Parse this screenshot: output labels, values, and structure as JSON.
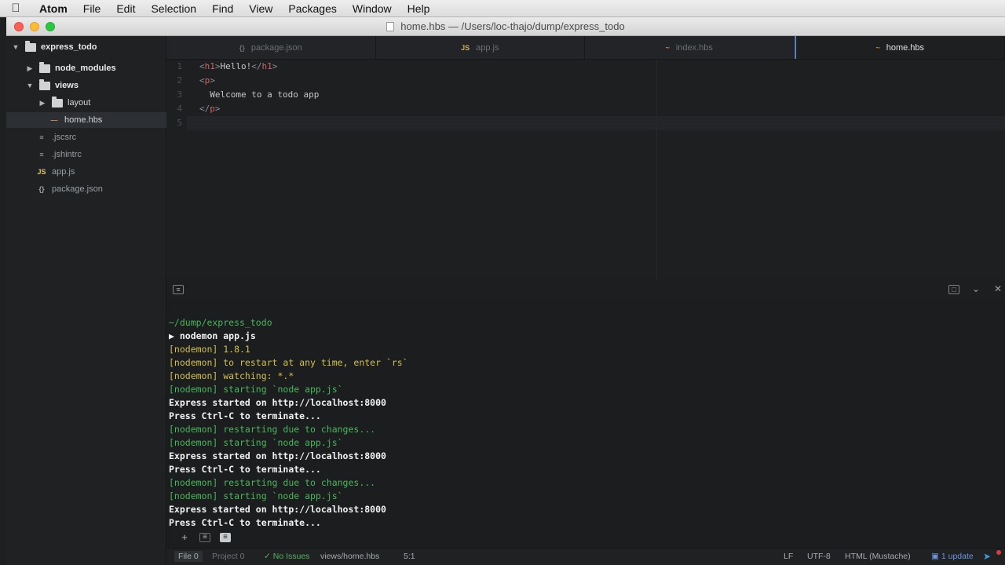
{
  "menubar": {
    "items": [
      "Atom",
      "File",
      "Edit",
      "Selection",
      "Find",
      "View",
      "Packages",
      "Window",
      "Help"
    ]
  },
  "window": {
    "title": "home.hbs — /Users/loc-thajo/dump/express_todo"
  },
  "tree": {
    "root": "express_todo",
    "items": [
      {
        "label": "node_modules",
        "type": "folder"
      },
      {
        "label": "views",
        "type": "folder"
      },
      {
        "label": "layout",
        "type": "folder"
      },
      {
        "label": "home.hbs",
        "type": "file-hbs"
      },
      {
        "label": ".jscsrc",
        "type": "file"
      },
      {
        "label": ".jshintrc",
        "type": "file"
      },
      {
        "label": "app.js",
        "type": "file-js"
      },
      {
        "label": "package.json",
        "type": "file-json"
      }
    ]
  },
  "tabs": [
    {
      "icon": "{}",
      "label": "package.json"
    },
    {
      "icon": "JS",
      "label": "app.js"
    },
    {
      "icon": "~",
      "label": "index.hbs"
    },
    {
      "icon": "~",
      "label": "home.hbs",
      "active": true
    }
  ],
  "editor": {
    "line_numbers": [
      "1",
      "2",
      "3",
      "4",
      "5"
    ],
    "lines": [
      {
        "open": "<",
        "tag": "h1",
        "close": ">",
        "text": "Hello!",
        "end_open": "</",
        "end_tag": "h1",
        "end_close": ">"
      },
      {
        "open": "<",
        "tag": "p",
        "close": ">"
      },
      {
        "text": "  Welcome to a todo app"
      },
      {
        "open": "</",
        "tag": "p",
        "close": ">"
      },
      {
        "text": ""
      }
    ]
  },
  "terminal": {
    "lines": [
      {
        "text": "~/dump/express_todo",
        "color": "green"
      },
      {
        "text": "▶ nodemon app.js",
        "color": "white"
      },
      {
        "text": "[nodemon] 1.8.1",
        "color": "yellow"
      },
      {
        "text": "[nodemon] to restart at any time, enter `rs`",
        "color": "yellow"
      },
      {
        "text": "[nodemon] watching: *.*",
        "color": "yellow"
      },
      {
        "text": "[nodemon] starting `node app.js`",
        "color": "green"
      },
      {
        "text": "Express started on http://localhost:8000",
        "color": "white"
      },
      {
        "text": "Press Ctrl-C to terminate...",
        "color": "white"
      },
      {
        "text": "[nodemon] restarting due to changes...",
        "color": "green"
      },
      {
        "text": "[nodemon] starting `node app.js`",
        "color": "green"
      },
      {
        "text": "Express started on http://localhost:8000",
        "color": "white"
      },
      {
        "text": "Press Ctrl-C to terminate...",
        "color": "white"
      },
      {
        "text": "[nodemon] restarting due to changes...",
        "color": "green"
      },
      {
        "text": "[nodemon] starting `node app.js`",
        "color": "green"
      },
      {
        "text": "Express started on http://localhost:8000",
        "color": "white"
      },
      {
        "text": "Press Ctrl-C to terminate...",
        "color": "white"
      }
    ]
  },
  "status": {
    "file_tab": "File 0",
    "project_tab": "Project 0",
    "linter": "No Issues",
    "path": "views/home.hbs",
    "cursor": "5:1",
    "line_ending": "LF",
    "encoding": "UTF-8",
    "grammar": "HTML (Mustache)",
    "updates": "1 update"
  },
  "colors": {
    "accent": "#5d7fbf",
    "terminal_green": "#48b85a",
    "terminal_yellow": "#d3c04a",
    "tag_red": "#cc6666"
  }
}
